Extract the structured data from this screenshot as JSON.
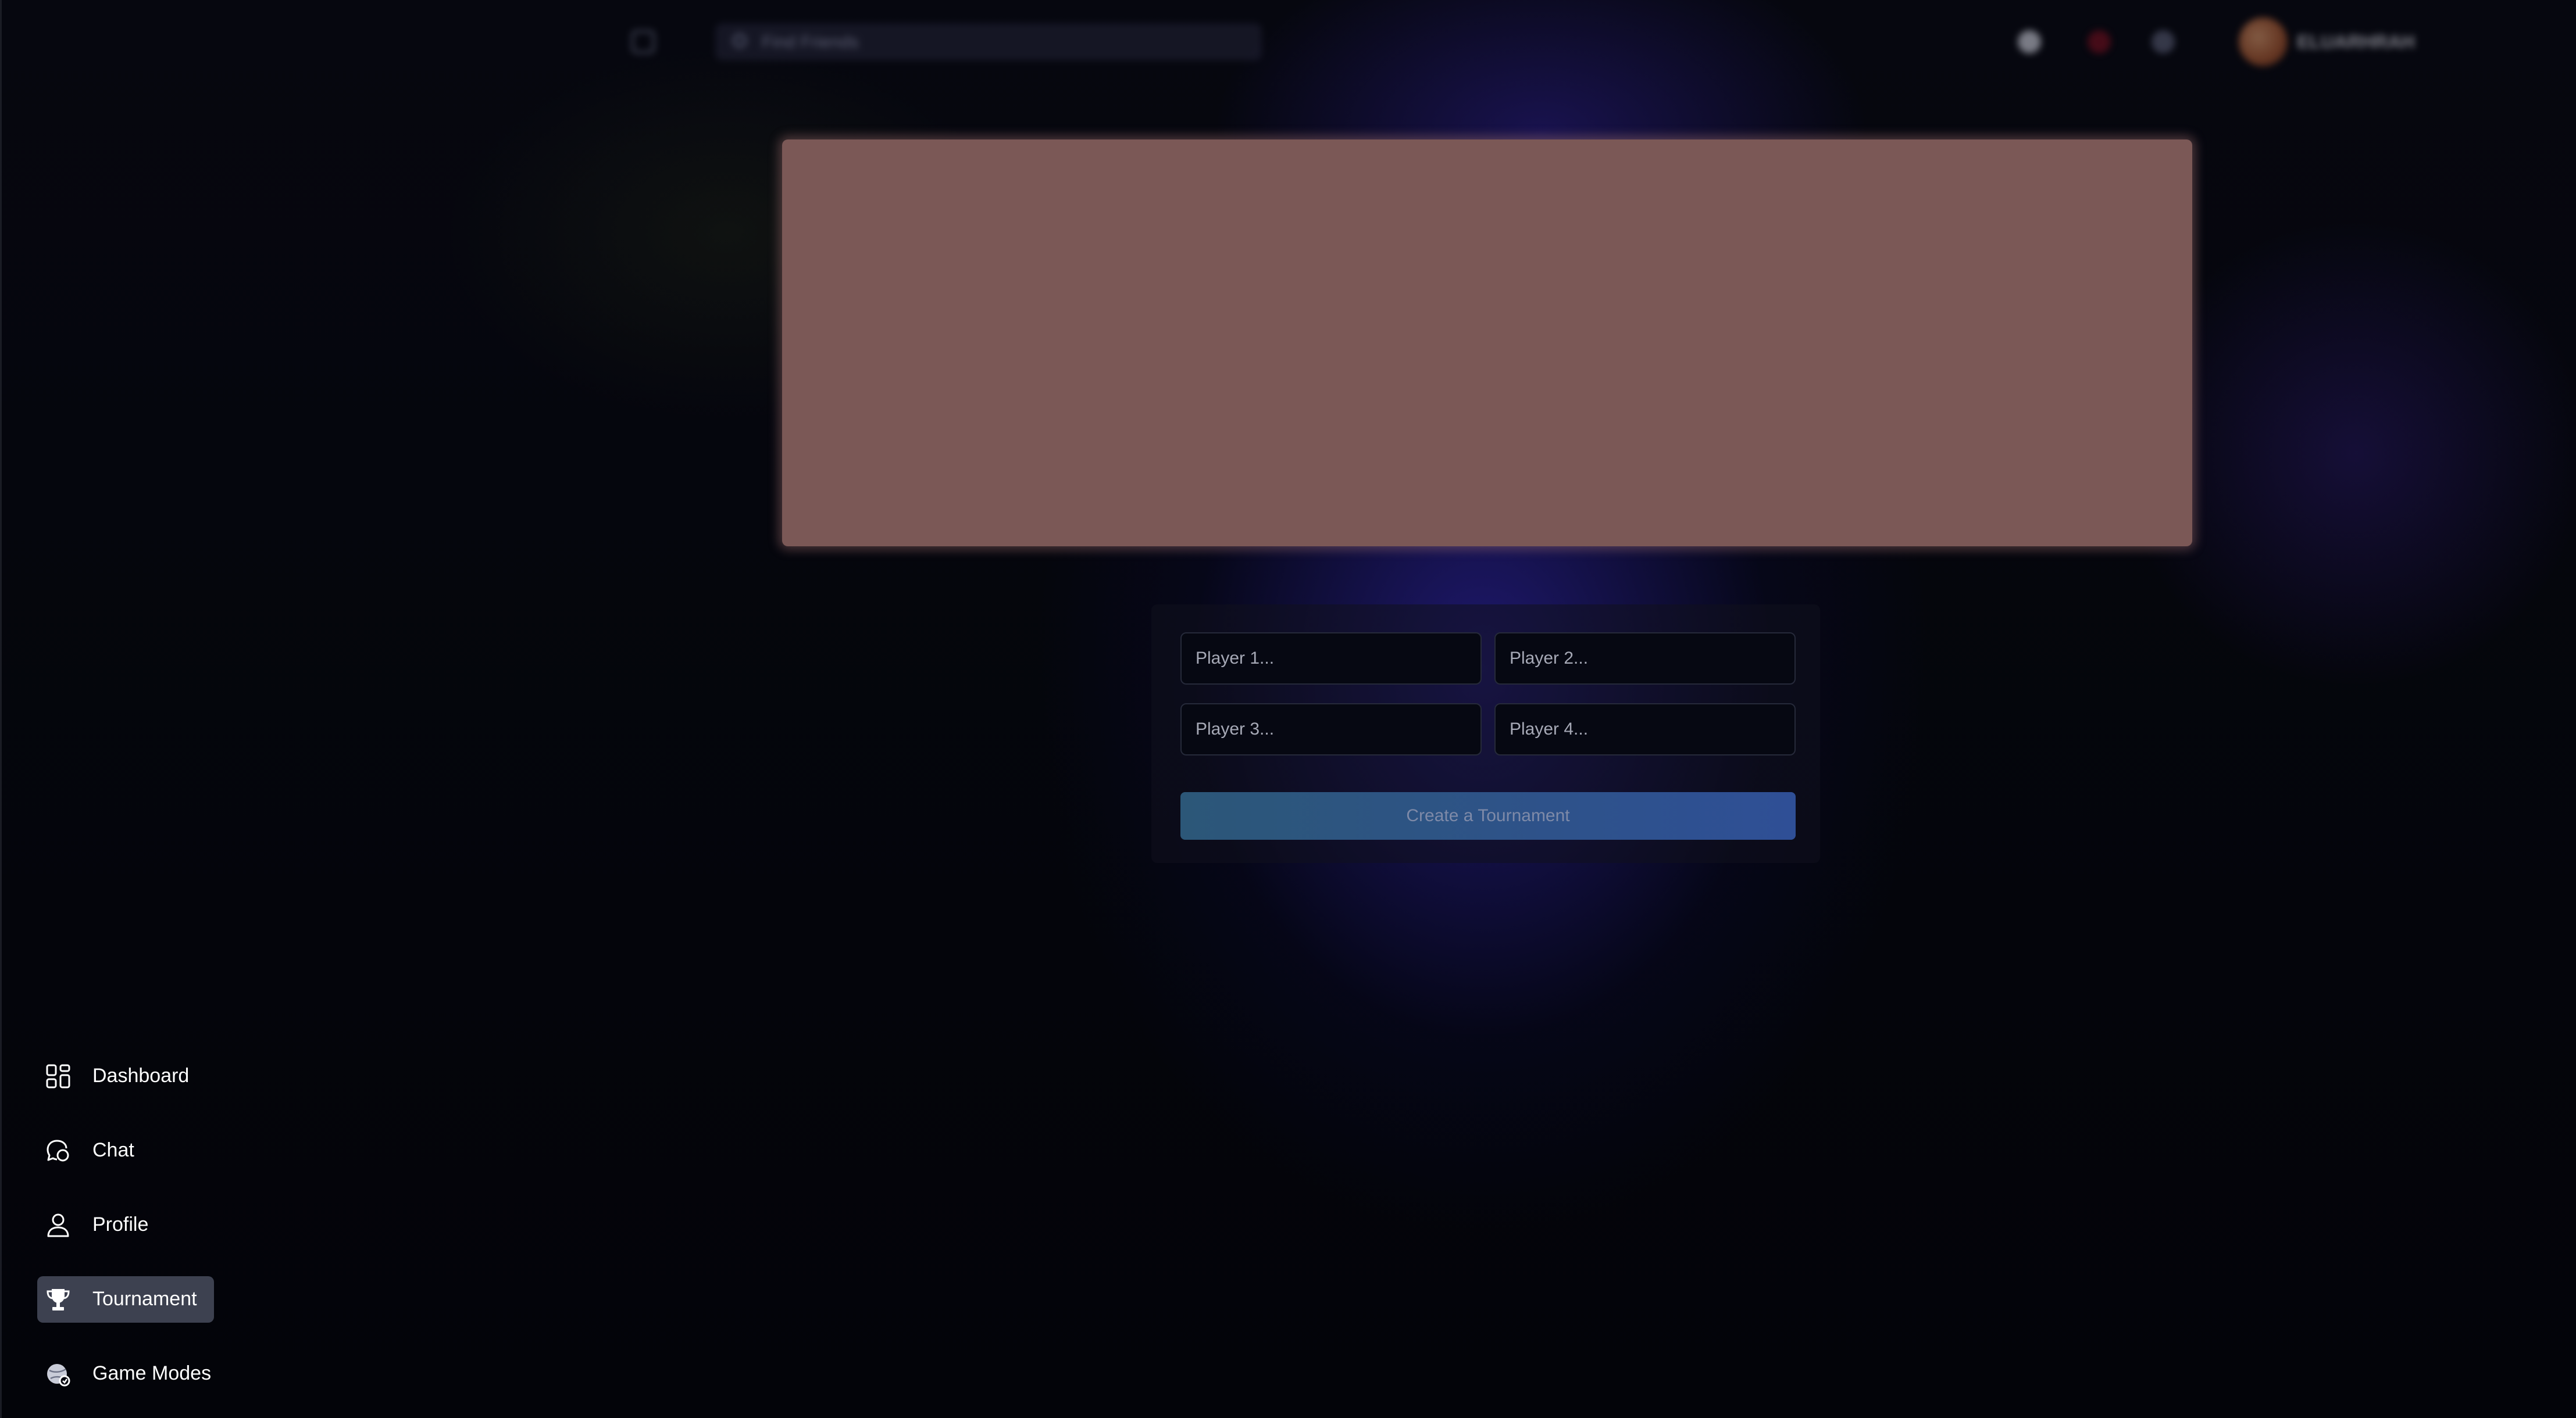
{
  "header": {
    "search_placeholder": "Find Friends",
    "username": "ELUARHRAH"
  },
  "tournament_form": {
    "player_placeholders": [
      "Player 1...",
      "Player 2...",
      "Player 3...",
      "Player 4..."
    ],
    "create_button_label": "Create a Tournament"
  },
  "sidebar": {
    "items": [
      {
        "label": "Dashboard",
        "icon": "grid-icon",
        "active": false
      },
      {
        "label": "Chat",
        "icon": "chat-bubble-icon",
        "active": false
      },
      {
        "label": "Profile",
        "icon": "user-icon",
        "active": false
      },
      {
        "label": "Tournament",
        "icon": "trophy-icon",
        "active": true
      },
      {
        "label": "Game Modes",
        "icon": "game-modes-icon",
        "active": false
      }
    ]
  },
  "colors": {
    "background": "#05060c",
    "banner": "#7b5856",
    "active_nav": "#3d4150",
    "button_gradient_start": "#2c5778",
    "button_gradient_end": "#2f4f96"
  }
}
